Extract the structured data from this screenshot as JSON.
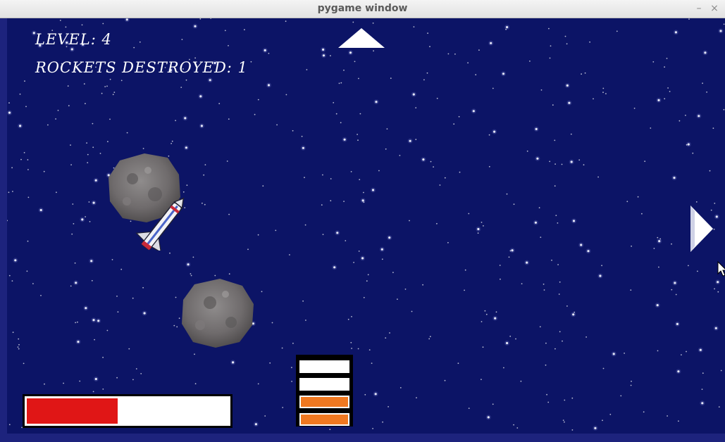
{
  "window": {
    "title": "pygame window",
    "minimize_glyph": "–",
    "close_glyph": "×"
  },
  "hud": {
    "level_label": "LEVEL: 4",
    "rockets_label": "ROCKETS DESTROYED: 1"
  },
  "health": {
    "fraction": 0.45,
    "fill_color": "#e01616"
  },
  "ammo": {
    "slots": [
      "empty",
      "empty",
      "loaded",
      "loaded"
    ],
    "loaded_color": "#f07820"
  },
  "colors": {
    "space": "#0c1466",
    "frame": "#1d237d"
  },
  "icons": {
    "up": "arrow-up-icon",
    "right": "arrow-right-icon"
  }
}
